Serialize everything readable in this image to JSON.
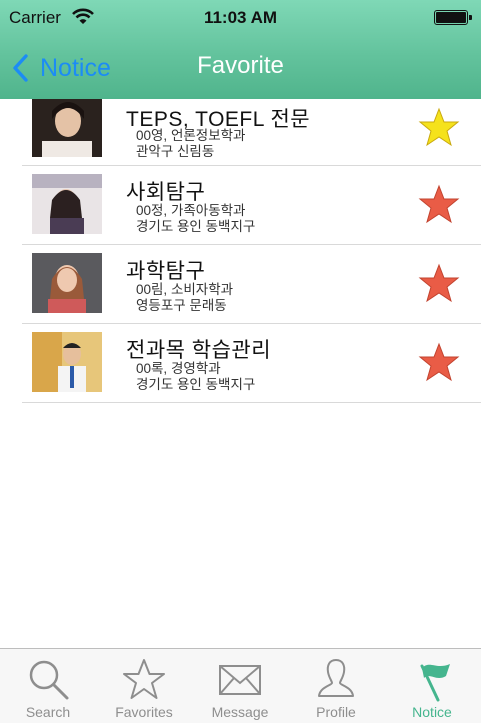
{
  "status_bar": {
    "carrier": "Carrier",
    "time": "11:03 AM"
  },
  "nav": {
    "back_label": "Notice",
    "title": "Favorite"
  },
  "rows": [
    {
      "title": "TEPS, TOEFL 전문",
      "line1": "00영, 언론정보학과",
      "line2": "관악구 신림동",
      "favorite_color": "#f5e21c"
    },
    {
      "title": "사회탐구",
      "line1": "00정, 가족아동학과",
      "line2": "경기도 용인 동백지구",
      "favorite_color": "#e95c46"
    },
    {
      "title": "과학탐구",
      "line1": "00림, 소비자학과",
      "line2": "영등포구 문래동",
      "favorite_color": "#e95c46"
    },
    {
      "title": "전과목 학습관리",
      "line1": "00록, 경영학과",
      "line2": "경기도 용인 동백지구",
      "favorite_color": "#e95c46"
    }
  ],
  "tabs": [
    {
      "label": "Search",
      "icon": "search-icon"
    },
    {
      "label": "Favorites",
      "icon": "star-icon"
    },
    {
      "label": "Message",
      "icon": "envelope-icon"
    },
    {
      "label": "Profile",
      "icon": "person-icon"
    },
    {
      "label": "Notice",
      "icon": "flag-icon",
      "active": true
    }
  ],
  "colors": {
    "header": "#63c39d",
    "accent_back": "#1c8cf5",
    "tab_active": "#45b58e"
  }
}
